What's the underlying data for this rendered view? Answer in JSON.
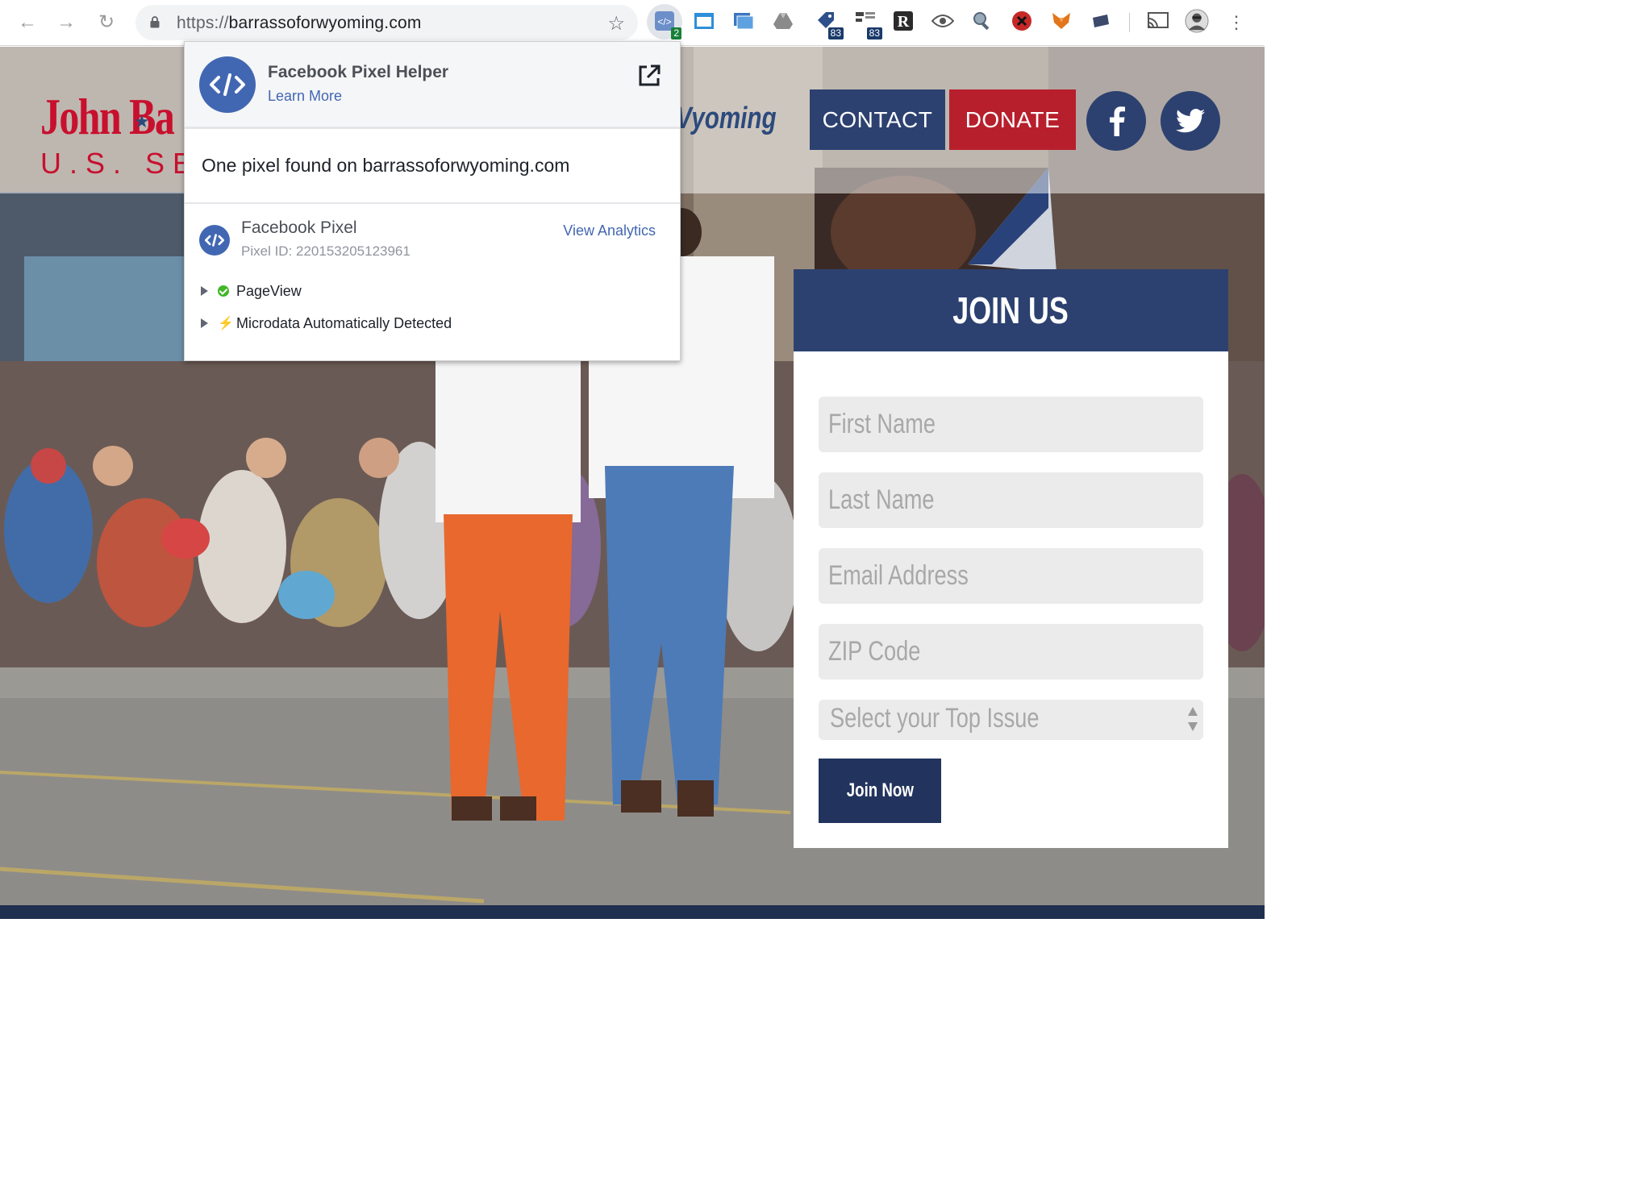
{
  "browser": {
    "url_scheme": "https://",
    "url_host": "barrassoforwyoming.com",
    "extensions": [
      {
        "name": "pixel-helper",
        "badge": "2",
        "badge_color": "#188038"
      },
      {
        "name": "window-icon"
      },
      {
        "name": "screenshot-icon"
      },
      {
        "name": "drive-icon"
      },
      {
        "name": "tag-icon",
        "badge": "83",
        "badge_color": "#1a3a6b"
      },
      {
        "name": "tree-icon",
        "badge": "83",
        "badge_color": "#1a3a6b"
      },
      {
        "name": "readability-icon",
        "letter": "R"
      },
      {
        "name": "eye-icon"
      },
      {
        "name": "inspect-icon"
      },
      {
        "name": "blocker-icon"
      },
      {
        "name": "fox-icon"
      },
      {
        "name": "card-icon"
      }
    ]
  },
  "site": {
    "logo_first": "John",
    "logo_partial": "Ba",
    "logo_sub": "U.S. SE",
    "logo_wy": "Vyoming",
    "contact": "CONTACT",
    "donate": "DONATE",
    "colors": {
      "navy": "#2c4170",
      "red": "#b81f2c"
    }
  },
  "join": {
    "heading": "JOIN US",
    "first_name": "First Name",
    "last_name": "Last Name",
    "email": "Email Address",
    "zip": "ZIP Code",
    "issue": "Select your Top Issue",
    "button": "Join Now"
  },
  "popup": {
    "title": "Facebook Pixel Helper",
    "learn_more": "Learn More",
    "summary": "One pixel found on barrassoforwyoming.com",
    "pixel_name": "Facebook Pixel",
    "pixel_id": "Pixel ID: 220153205123961",
    "view_analytics": "View Analytics",
    "events": [
      "PageView",
      "Microdata Automatically Detected"
    ]
  }
}
